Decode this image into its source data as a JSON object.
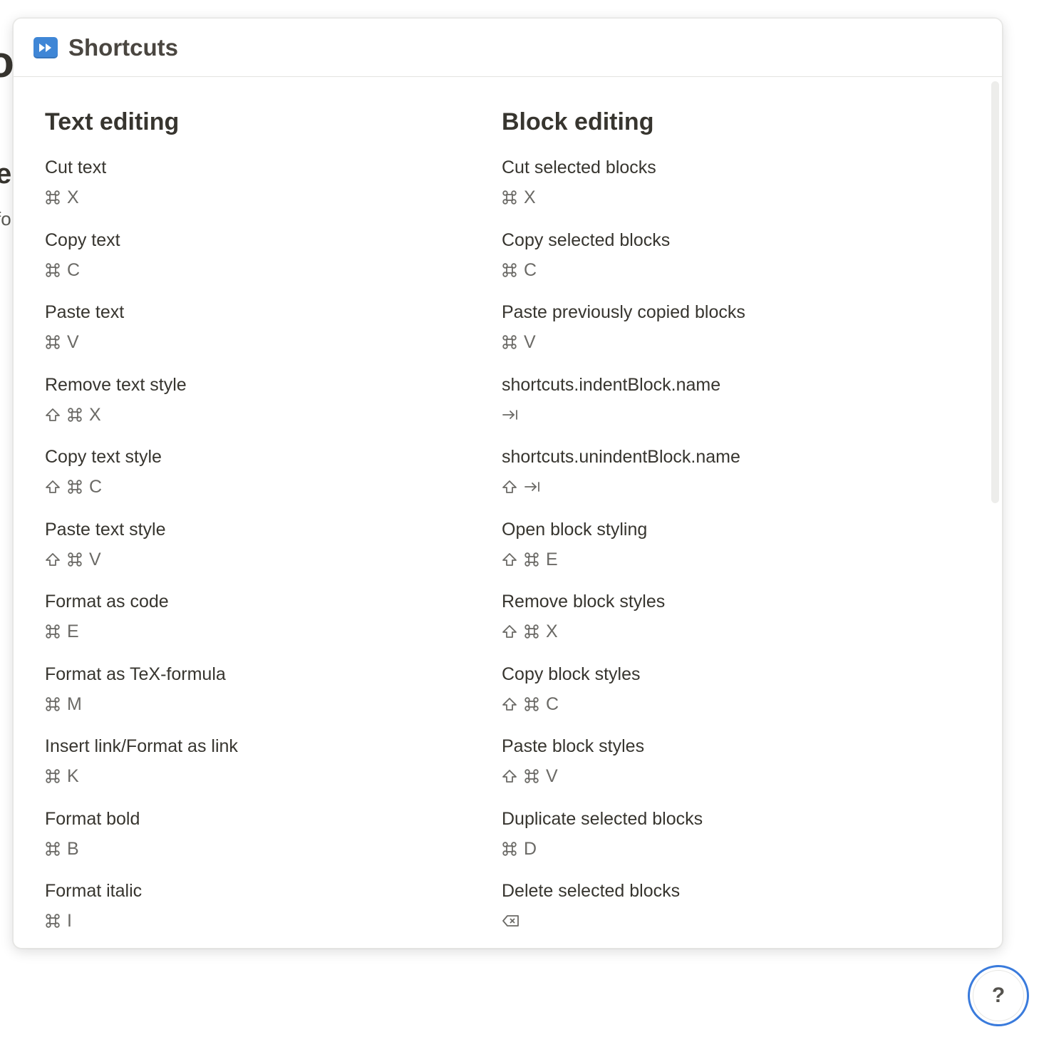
{
  "modal": {
    "title": "Shortcuts",
    "icon": "fast-forward-icon"
  },
  "columns": [
    {
      "title": "Text editing",
      "items": [
        {
          "label": "Cut text",
          "keys": [
            "cmd",
            "X"
          ]
        },
        {
          "label": "Copy text",
          "keys": [
            "cmd",
            "C"
          ]
        },
        {
          "label": "Paste text",
          "keys": [
            "cmd",
            "V"
          ]
        },
        {
          "label": "Remove text style",
          "keys": [
            "shift",
            "cmd",
            "X"
          ]
        },
        {
          "label": "Copy text style",
          "keys": [
            "shift",
            "cmd",
            "C"
          ]
        },
        {
          "label": "Paste text style",
          "keys": [
            "shift",
            "cmd",
            "V"
          ]
        },
        {
          "label": "Format as code",
          "keys": [
            "cmd",
            "E"
          ]
        },
        {
          "label": "Format as TeX-formula",
          "keys": [
            "cmd",
            "M"
          ]
        },
        {
          "label": "Insert link/Format as link",
          "keys": [
            "cmd",
            "K"
          ]
        },
        {
          "label": "Format bold",
          "keys": [
            "cmd",
            "B"
          ]
        },
        {
          "label": "Format italic",
          "keys": [
            "cmd",
            "I"
          ]
        }
      ]
    },
    {
      "title": "Block editing",
      "items": [
        {
          "label": "Cut selected blocks",
          "keys": [
            "cmd",
            "X"
          ]
        },
        {
          "label": "Copy selected blocks",
          "keys": [
            "cmd",
            "C"
          ]
        },
        {
          "label": "Paste previously copied blocks",
          "keys": [
            "cmd",
            "V"
          ]
        },
        {
          "label": "shortcuts.indentBlock.name",
          "keys": [
            "tab"
          ]
        },
        {
          "label": "shortcuts.unindentBlock.name",
          "keys": [
            "shift",
            "tab"
          ]
        },
        {
          "label": "Open block styling",
          "keys": [
            "shift",
            "cmd",
            "E"
          ]
        },
        {
          "label": "Remove block styles",
          "keys": [
            "shift",
            "cmd",
            "X"
          ]
        },
        {
          "label": "Copy block styles",
          "keys": [
            "shift",
            "cmd",
            "C"
          ]
        },
        {
          "label": "Paste block styles",
          "keys": [
            "shift",
            "cmd",
            "V"
          ]
        },
        {
          "label": "Duplicate selected blocks",
          "keys": [
            "cmd",
            "D"
          ]
        },
        {
          "label": "Delete selected blocks",
          "keys": [
            "backspace"
          ]
        }
      ]
    }
  ],
  "help_button": {
    "label": "?"
  },
  "background_peek": [
    "o",
    "e",
    "fo"
  ],
  "colors": {
    "accent": "#3a7bdc",
    "icon_bg": "#3f86d6",
    "text": "#37352f",
    "muted": "#6b6a66"
  }
}
